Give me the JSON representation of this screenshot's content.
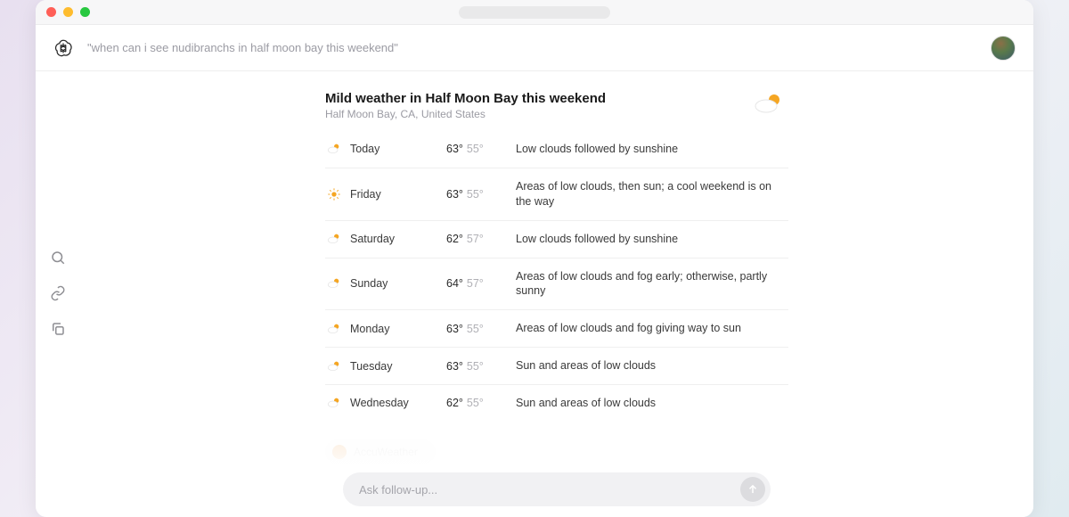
{
  "header": {
    "query_display": "\"when can i see nudibranchs in half moon bay this weekend\""
  },
  "weather_card": {
    "title": "Mild weather in Half Moon Bay this weekend",
    "subtitle": "Half Moon Bay, CA, United States",
    "hero_icon": "partly-cloudy",
    "forecast": [
      {
        "icon": "partly-cloudy",
        "day": "Today",
        "high": "63°",
        "low": "55°",
        "desc": "Low clouds followed by sunshine"
      },
      {
        "icon": "sunny",
        "day": "Friday",
        "high": "63°",
        "low": "55°",
        "desc": "Areas of low clouds, then sun; a cool weekend is on the way"
      },
      {
        "icon": "partly-cloudy",
        "day": "Saturday",
        "high": "62°",
        "low": "57°",
        "desc": "Low clouds followed by sunshine"
      },
      {
        "icon": "partly-cloudy",
        "day": "Sunday",
        "high": "64°",
        "low": "57°",
        "desc": "Areas of low clouds and fog early; otherwise, partly sunny"
      },
      {
        "icon": "partly-cloudy",
        "day": "Monday",
        "high": "63°",
        "low": "55°",
        "desc": "Areas of low clouds and fog giving way to sun"
      },
      {
        "icon": "partly-cloudy",
        "day": "Tuesday",
        "high": "63°",
        "low": "55°",
        "desc": "Sun and areas of low clouds"
      },
      {
        "icon": "partly-cloudy",
        "day": "Wednesday",
        "high": "62°",
        "low": "55°",
        "desc": "Sun and areas of low clouds"
      }
    ]
  },
  "source": {
    "name": "AccuWeather"
  },
  "composer": {
    "placeholder": "Ask follow-up..."
  }
}
